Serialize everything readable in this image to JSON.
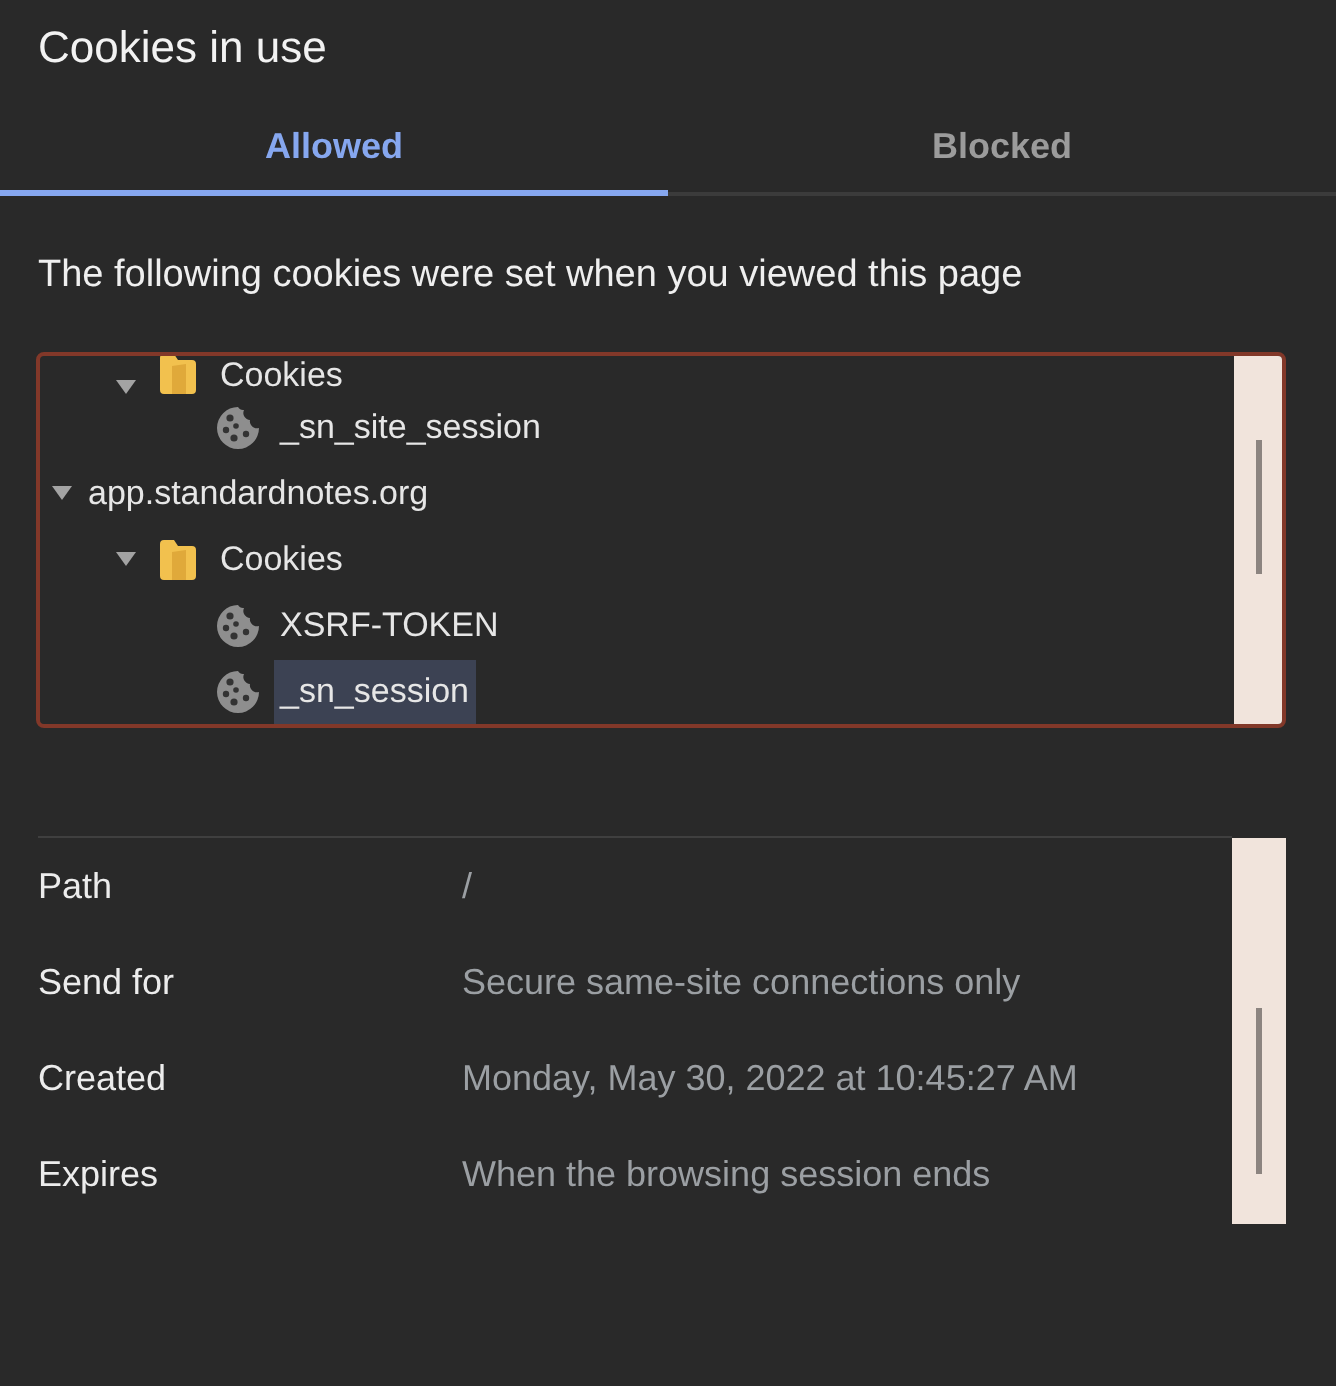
{
  "dialog": {
    "title": "Cookies in use"
  },
  "tabs": [
    {
      "label": "Allowed",
      "selected": true
    },
    {
      "label": "Blocked",
      "selected": false
    }
  ],
  "description": "The following cookies were set when you viewed this page",
  "cookie_tree": {
    "items": [
      {
        "children": [
          {
            "label": "Cookies",
            "kind": "folder",
            "expanded": true,
            "selected": false,
            "children": [
              {
                "label": "_sn_site_session",
                "kind": "cookie",
                "selected": false
              }
            ]
          }
        ]
      },
      {
        "label": "app.standardnotes.org",
        "expanded": true,
        "selected": false,
        "children": [
          {
            "label": "Cookies",
            "kind": "folder",
            "expanded": true,
            "selected": false,
            "children": [
              {
                "label": "XSRF-TOKEN",
                "kind": "cookie",
                "selected": false
              },
              {
                "label": "_sn_session",
                "kind": "cookie",
                "selected": true
              }
            ]
          }
        ]
      }
    ]
  },
  "details": [
    {
      "label": "Path",
      "value": "/"
    },
    {
      "label": "Send for",
      "value": "Secure same-site connections only"
    },
    {
      "label": "Created",
      "value": "Monday, May 30, 2022 at 10:45:27 AM"
    },
    {
      "label": "Expires",
      "value": "When the browsing session ends"
    }
  ]
}
